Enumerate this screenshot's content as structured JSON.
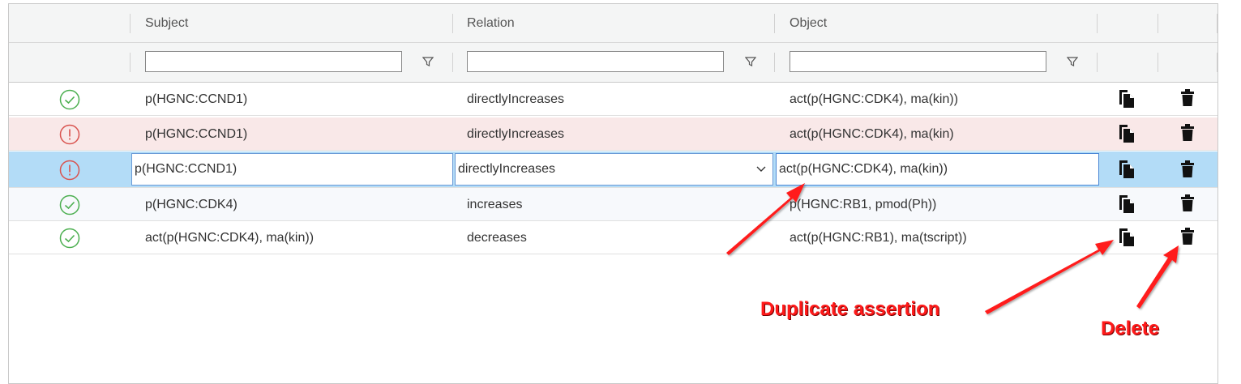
{
  "columns": {
    "subject": "Subject",
    "relation": "Relation",
    "object": "Object"
  },
  "filters": {
    "subject_value": "",
    "relation_value": "",
    "object_value": ""
  },
  "rows": [
    {
      "status": "valid",
      "subject": "p(HGNC:CCND1)",
      "relation": "directlyIncreases",
      "object": "act(p(HGNC:CDK4), ma(kin))"
    },
    {
      "status": "error",
      "subject": "p(HGNC:CCND1)",
      "relation": "directlyIncreases",
      "object": "act(p(HGNC:CDK4), ma(kin)"
    },
    {
      "status": "error",
      "subject": "p(HGNC:CCND1)",
      "relation": "directlyIncreases",
      "object": "act(p(HGNC:CDK4), ma(kin))",
      "editing": true
    },
    {
      "status": "valid",
      "subject": "p(HGNC:CDK4)",
      "relation": "increases",
      "object": "p(HGNC:RB1, pmod(Ph))"
    },
    {
      "status": "valid",
      "subject": "act(p(HGNC:CDK4), ma(kin))",
      "relation": "decreases",
      "object": "act(p(HGNC:RB1), ma(tscript))"
    }
  ],
  "icons": {
    "valid": "check-circle-icon",
    "error": "exclamation-circle-icon",
    "copy": "copy-icon",
    "delete": "trash-icon",
    "filter": "funnel-icon"
  },
  "annotations": {
    "duplicate": "Duplicate assertion",
    "delete": "Delete"
  },
  "colors": {
    "valid": "#4caf50",
    "error": "#d9534f",
    "selected_row": "#b3dcf7",
    "error_row": "#f9e8e8",
    "annotation": "#ff1a1a"
  }
}
